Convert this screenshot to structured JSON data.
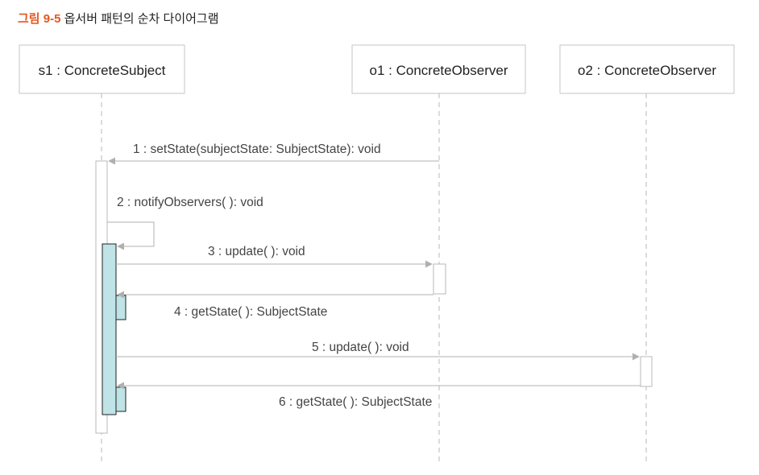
{
  "caption": {
    "prefix": "그림 9-5",
    "title": "옵서버 패턴의 순차 다이어그램"
  },
  "participants": [
    {
      "id": "s1",
      "label": "s1 : ConcreteSubject"
    },
    {
      "id": "o1",
      "label": "o1 : ConcreteObserver"
    },
    {
      "id": "o2",
      "label": "o2 : ConcreteObserver"
    }
  ],
  "messages": [
    {
      "label": "1 : setState(subjectState: SubjectState): void",
      "from": "o1",
      "to": "s1"
    },
    {
      "label": "2 : notifyObservers( ): void",
      "from": "s1",
      "to": "s1"
    },
    {
      "label": "3 : update( ): void",
      "from": "s1",
      "to": "o1"
    },
    {
      "label": "4 : getState( ): SubjectState",
      "from": "o1",
      "to": "s1"
    },
    {
      "label": "5 : update( ): void",
      "from": "s1",
      "to": "o2"
    },
    {
      "label": "6 : getState( ): SubjectState",
      "from": "o2",
      "to": "s1"
    }
  ],
  "colors": {
    "activation_fill": "#bfe3e6",
    "line": "#b0b0b0",
    "caption_accent": "#e4571f"
  }
}
